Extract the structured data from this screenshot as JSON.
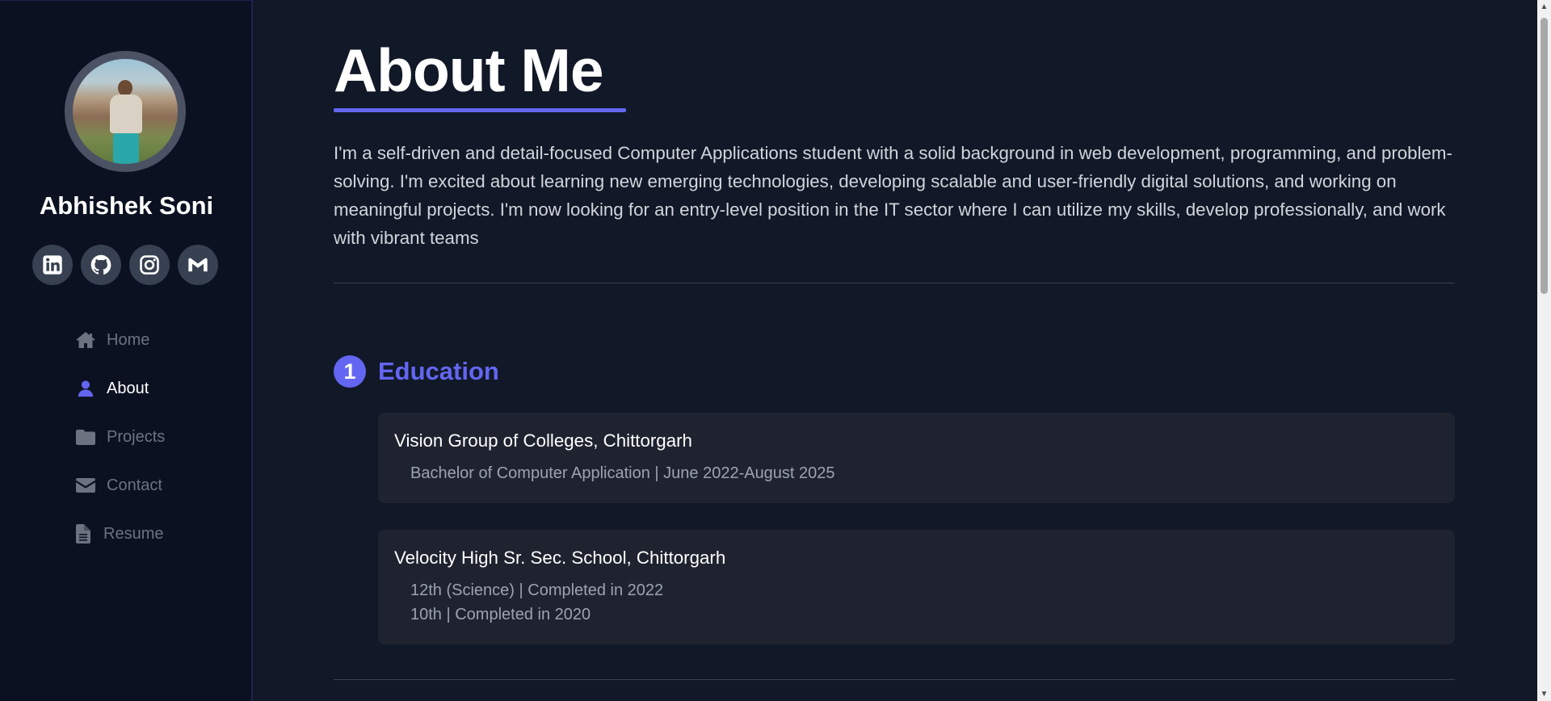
{
  "sidebar": {
    "profile_name": "Abhishek Soni",
    "socials": [
      {
        "icon": "linkedin-icon"
      },
      {
        "icon": "github-icon"
      },
      {
        "icon": "instagram-icon"
      },
      {
        "icon": "gmail-icon"
      }
    ],
    "nav": [
      {
        "label": "Home",
        "icon": "home-icon",
        "active": false
      },
      {
        "label": "About",
        "icon": "user-icon",
        "active": true
      },
      {
        "label": "Projects",
        "icon": "folder-icon",
        "active": false
      },
      {
        "label": "Contact",
        "icon": "envelope-icon",
        "active": false
      },
      {
        "label": "Resume",
        "icon": "file-icon",
        "active": false
      }
    ]
  },
  "main": {
    "title": "About Me",
    "bio": "I'm a self-driven and detail-focused Computer Applications student with a solid background in web development, programming, and problem-solving. I'm excited about learning new emerging technologies, developing scalable and user-friendly digital solutions, and working on meaningful projects. I'm now looking for an entry-level position in the IT sector where I can utilize my skills, develop professionally, and work with vibrant teams",
    "education": {
      "number": "1",
      "title": "Education",
      "entries": [
        {
          "school": "Vision Group of Colleges, Chittorgarh",
          "lines": [
            "Bachelor of Computer Application | June 2022-August 2025"
          ]
        },
        {
          "school": "Velocity High Sr. Sec. School, Chittorgarh",
          "lines": [
            "12th (Science) | Completed in 2022",
            "10th | Completed in 2020"
          ]
        }
      ]
    }
  },
  "colors": {
    "accent": "#6366f1",
    "sidebar_bg": "#0b1121",
    "page_bg": "#111827",
    "card_bg": "#1f2330"
  }
}
